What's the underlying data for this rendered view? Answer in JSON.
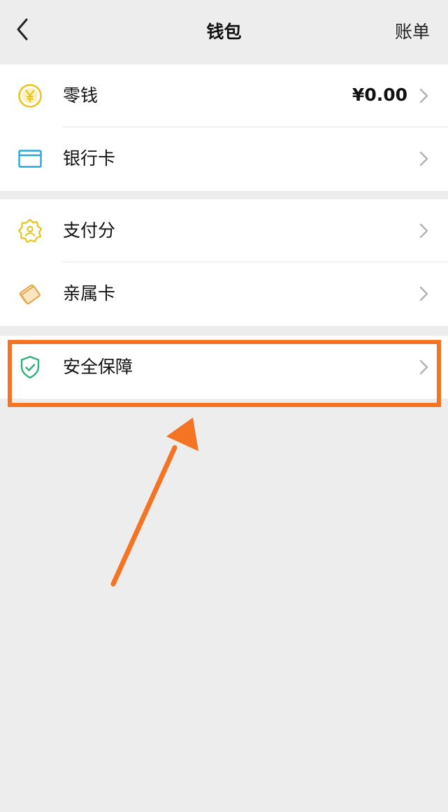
{
  "header": {
    "title": "钱包",
    "right_link": "账单",
    "back_icon": "chevron-left-icon"
  },
  "groups": [
    {
      "items": [
        {
          "label": "零钱",
          "value": "¥0.00",
          "icon": "yen-coin-icon",
          "icon_color": "#e8c31a"
        },
        {
          "label": "银行卡",
          "icon": "bank-card-icon",
          "icon_color": "#2aa7d8"
        }
      ]
    },
    {
      "items": [
        {
          "label": "支付分",
          "icon": "payment-score-badge-icon",
          "icon_color": "#e8c31a"
        },
        {
          "label": "亲属卡",
          "icon": "family-card-icon",
          "icon_color": "#e9a64a"
        }
      ]
    },
    {
      "items": [
        {
          "label": "安全保障",
          "icon": "shield-check-icon",
          "icon_color": "#2bb37a"
        }
      ]
    }
  ],
  "annotation": {
    "highlight_color": "#f47424"
  },
  "colors": {
    "background": "#ededed",
    "card": "#ffffff",
    "chevron": "#b2b2b2"
  }
}
